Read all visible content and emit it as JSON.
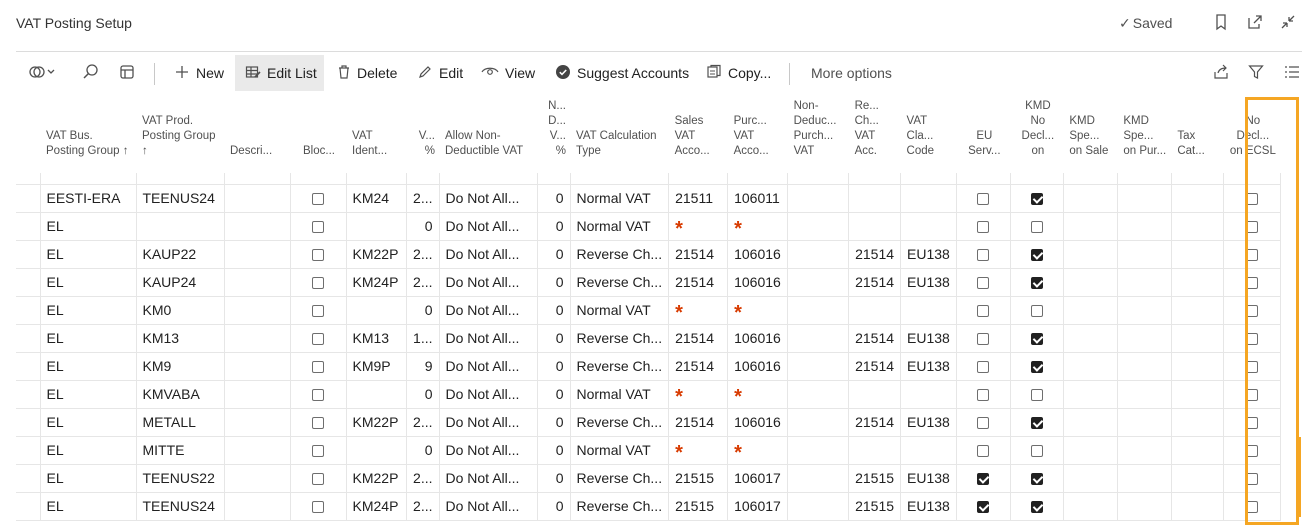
{
  "window": {
    "title": "VAT Posting Setup",
    "saved_label": "Saved"
  },
  "actions": {
    "new": "New",
    "edit_list": "Edit List",
    "delete": "Delete",
    "edit": "Edit",
    "view": "View",
    "suggest_accounts": "Suggest Accounts",
    "copy": "Copy...",
    "more_options": "More options"
  },
  "columns": [
    {
      "key": "bus",
      "label": "VAT Bus. Posting Group ↑"
    },
    {
      "key": "prod",
      "label": "VAT Prod. Posting Group ↑"
    },
    {
      "key": "desc",
      "label": "Descri..."
    },
    {
      "key": "blocked",
      "label": "Bloc..."
    },
    {
      "key": "ident",
      "label": "VAT Ident..."
    },
    {
      "key": "vatpct",
      "label": "V... %"
    },
    {
      "key": "allow",
      "label": "Allow Non-Deductible VAT"
    },
    {
      "key": "ndpct",
      "label": "N... D... V... %"
    },
    {
      "key": "calc",
      "label": "VAT Calculation Type"
    },
    {
      "key": "sales",
      "label": "Sales VAT Acco..."
    },
    {
      "key": "purch",
      "label": "Purc... VAT Acco..."
    },
    {
      "key": "nondp",
      "label": "Non-Deduc... Purch... VAT"
    },
    {
      "key": "rev",
      "label": "Re... Ch... VAT Acc."
    },
    {
      "key": "clause",
      "label": "VAT Cla... Code"
    },
    {
      "key": "eu",
      "label": "EU Serv..."
    },
    {
      "key": "kmdno",
      "label": "KMD No Decl... on"
    },
    {
      "key": "kmdsale",
      "label": "KMD Spe... on Sale"
    },
    {
      "key": "kmdpur",
      "label": "KMD Spe... on Pur..."
    },
    {
      "key": "taxcat",
      "label": "Tax Cat..."
    },
    {
      "key": "ecsl",
      "label": "No Decl... on ECSL"
    }
  ],
  "rows": [
    {
      "bus": "EESTI-ERA",
      "prod": "TEENUS24",
      "blocked": false,
      "ident": "KM24",
      "vatpct": "2...",
      "allow": "Do Not All...",
      "ndpct": "0",
      "calc": "Normal VAT",
      "sales": "21511",
      "purch": "106011",
      "rev": "",
      "clause": "",
      "eu": false,
      "kmdno": true,
      "ecsl": false
    },
    {
      "bus": "EL",
      "prod": "",
      "blocked": false,
      "ident": "",
      "vatpct": "0",
      "allow": "Do Not All...",
      "ndpct": "0",
      "calc": "Normal VAT",
      "sales": "*",
      "purch": "*",
      "rev": "",
      "clause": "",
      "eu": false,
      "kmdno": false,
      "ecsl": false
    },
    {
      "bus": "EL",
      "prod": "KAUP22",
      "blocked": false,
      "ident": "KM22P",
      "vatpct": "2...",
      "allow": "Do Not All...",
      "ndpct": "0",
      "calc": "Reverse Ch...",
      "sales": "21514",
      "purch": "106016",
      "rev": "21514",
      "clause": "EU138",
      "eu": false,
      "kmdno": true,
      "ecsl": false
    },
    {
      "bus": "EL",
      "prod": "KAUP24",
      "blocked": false,
      "ident": "KM24P",
      "vatpct": "2...",
      "allow": "Do Not All...",
      "ndpct": "0",
      "calc": "Reverse Ch...",
      "sales": "21514",
      "purch": "106016",
      "rev": "21514",
      "clause": "EU138",
      "eu": false,
      "kmdno": true,
      "ecsl": false
    },
    {
      "bus": "EL",
      "prod": "KM0",
      "blocked": false,
      "ident": "",
      "vatpct": "0",
      "allow": "Do Not All...",
      "ndpct": "0",
      "calc": "Normal VAT",
      "sales": "*",
      "purch": "*",
      "rev": "",
      "clause": "",
      "eu": false,
      "kmdno": false,
      "ecsl": false
    },
    {
      "bus": "EL",
      "prod": "KM13",
      "blocked": false,
      "ident": "KM13",
      "vatpct": "1...",
      "allow": "Do Not All...",
      "ndpct": "0",
      "calc": "Reverse Ch...",
      "sales": "21514",
      "purch": "106016",
      "rev": "21514",
      "clause": "EU138",
      "eu": false,
      "kmdno": true,
      "ecsl": false
    },
    {
      "bus": "EL",
      "prod": "KM9",
      "blocked": false,
      "ident": "KM9P",
      "vatpct": "9",
      "allow": "Do Not All...",
      "ndpct": "0",
      "calc": "Reverse Ch...",
      "sales": "21514",
      "purch": "106016",
      "rev": "21514",
      "clause": "EU138",
      "eu": false,
      "kmdno": true,
      "ecsl": false
    },
    {
      "bus": "EL",
      "prod": "KMVABA",
      "blocked": false,
      "ident": "",
      "vatpct": "0",
      "allow": "Do Not All...",
      "ndpct": "0",
      "calc": "Normal VAT",
      "sales": "*",
      "purch": "*",
      "rev": "",
      "clause": "",
      "eu": false,
      "kmdno": false,
      "ecsl": false
    },
    {
      "bus": "EL",
      "prod": "METALL",
      "blocked": false,
      "ident": "KM22P",
      "vatpct": "2...",
      "allow": "Do Not All...",
      "ndpct": "0",
      "calc": "Reverse Ch...",
      "sales": "21514",
      "purch": "106016",
      "rev": "21514",
      "clause": "EU138",
      "eu": false,
      "kmdno": true,
      "ecsl": false
    },
    {
      "bus": "EL",
      "prod": "MITTE",
      "blocked": false,
      "ident": "",
      "vatpct": "0",
      "allow": "Do Not All...",
      "ndpct": "0",
      "calc": "Normal VAT",
      "sales": "*",
      "purch": "*",
      "rev": "",
      "clause": "",
      "eu": false,
      "kmdno": false,
      "ecsl": false
    },
    {
      "bus": "EL",
      "prod": "TEENUS22",
      "blocked": false,
      "ident": "KM22P",
      "vatpct": "2...",
      "allow": "Do Not All...",
      "ndpct": "0",
      "calc": "Reverse Ch...",
      "sales": "21515",
      "purch": "106017",
      "rev": "21515",
      "clause": "EU138",
      "eu": true,
      "kmdno": true,
      "ecsl": false
    },
    {
      "bus": "EL",
      "prod": "TEENUS24",
      "blocked": false,
      "ident": "KM24P",
      "vatpct": "2...",
      "allow": "Do Not All...",
      "ndpct": "0",
      "calc": "Reverse Ch...",
      "sales": "21515",
      "purch": "106017",
      "rev": "21515",
      "clause": "EU138",
      "eu": true,
      "kmdno": true,
      "ecsl": false
    }
  ],
  "colors": {
    "highlight": "#f5a623",
    "required": "#d83b01"
  },
  "icons": [
    "bookmark-icon",
    "open-new-window-icon",
    "collapse-icon",
    "filter-view-icon",
    "search-icon",
    "analysis-mode-icon",
    "plus-icon",
    "edit-list-icon",
    "trash-icon",
    "pencil-icon",
    "eye-icon",
    "suggest-icon",
    "copy-icon",
    "share-icon",
    "filter-icon",
    "list-icon"
  ]
}
